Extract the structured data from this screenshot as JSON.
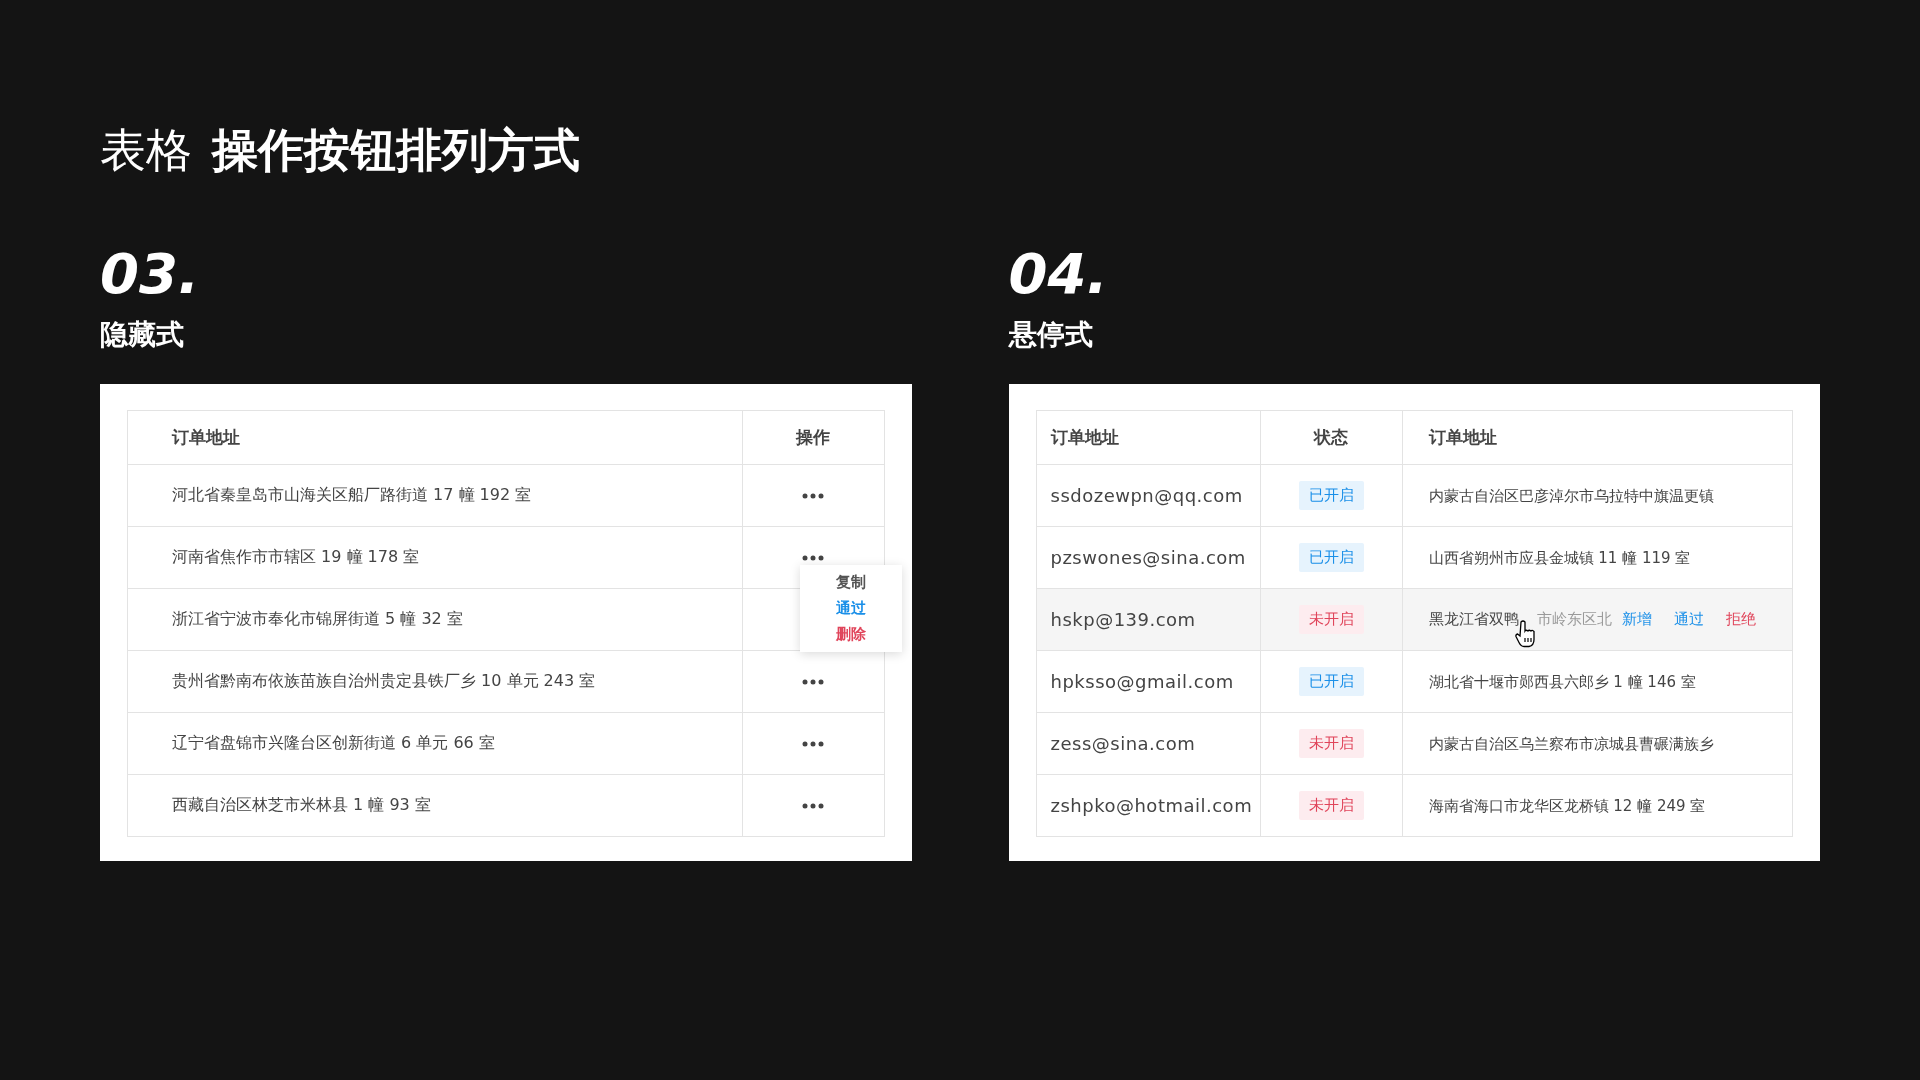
{
  "title": {
    "plain": "表格",
    "bold": "操作按钮排列方式"
  },
  "hidden_style": {
    "number": "03.",
    "name": "隐藏式",
    "columns": [
      "订单地址",
      "操作"
    ],
    "rows": [
      {
        "address": "河北省秦皇岛市山海关区船厂路街道 17 幢 192 室",
        "menu_open": false
      },
      {
        "address": "河南省焦作市市辖区 19 幢 178 室",
        "menu_open": true
      },
      {
        "address": "浙江省宁波市奉化市锦屏街道 5 幢 32 室",
        "menu_open": false
      },
      {
        "address": "贵州省黔南布依族苗族自治州贵定县铁厂乡 10 单元 243 室",
        "menu_open": false
      },
      {
        "address": "辽宁省盘锦市兴隆台区创新街道 6 单元 66 室",
        "menu_open": false
      },
      {
        "address": "西藏自治区林芝市米林县 1 幢 93 室",
        "menu_open": false
      }
    ],
    "menu_items": [
      {
        "label": "复制",
        "kind": "neutral"
      },
      {
        "label": "通过",
        "kind": "primary"
      },
      {
        "label": "删除",
        "kind": "danger"
      }
    ]
  },
  "hover_style": {
    "number": "04.",
    "name": "悬停式",
    "columns": [
      "订单地址",
      "状态",
      "订单地址"
    ],
    "rows": [
      {
        "email": "ssdozewpn@qq.com",
        "status": {
          "label": "已开启",
          "kind": "on"
        },
        "address": "内蒙古自治区巴彦淖尔市乌拉特中旗温更镇",
        "hovered": false
      },
      {
        "email": "pzswones@sina.com",
        "status": {
          "label": "已开启",
          "kind": "on"
        },
        "address": "山西省朔州市应县金城镇 11 幢 119 室",
        "hovered": false
      },
      {
        "email": "hskp@139.com",
        "status": {
          "label": "未开启",
          "kind": "off"
        },
        "address": "黑龙江省双鸭",
        "address_tail": "市岭东区北",
        "hovered": true,
        "actions": [
          {
            "label": "新增",
            "kind": "primary"
          },
          {
            "label": "通过",
            "kind": "primary"
          },
          {
            "label": "拒绝",
            "kind": "danger"
          }
        ]
      },
      {
        "email": "hpksso@gmail.com",
        "status": {
          "label": "已开启",
          "kind": "on"
        },
        "address": "湖北省十堰市郧西县六郎乡 1 幢 146 室",
        "hovered": false
      },
      {
        "email": "zess@sina.com",
        "status": {
          "label": "未开启",
          "kind": "off"
        },
        "address": "内蒙古自治区乌兰察布市凉城县曹碾满族乡",
        "hovered": false
      },
      {
        "email": "zshpko@hotmail.com",
        "status": {
          "label": "未开启",
          "kind": "off"
        },
        "address": "海南省海口市龙华区龙桥镇 12 幢 249 室",
        "hovered": false
      }
    ]
  }
}
